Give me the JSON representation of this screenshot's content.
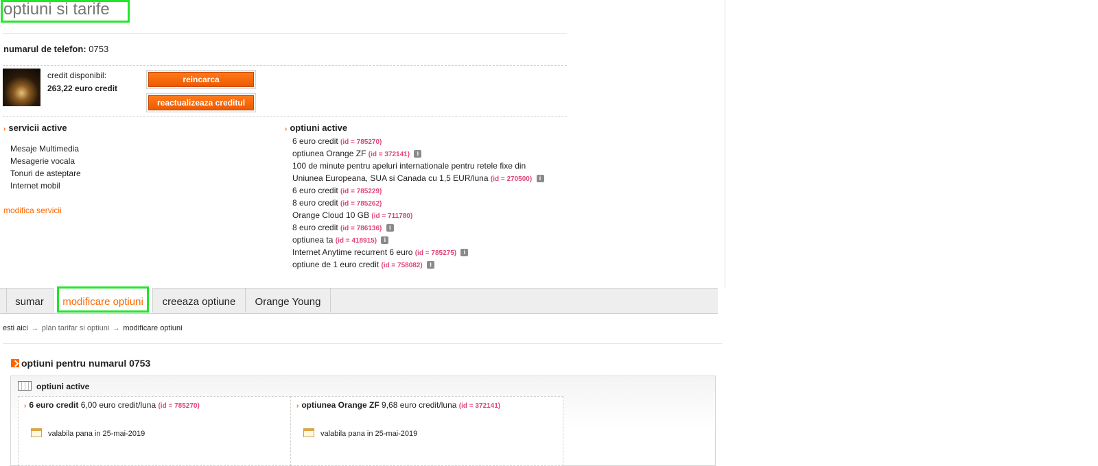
{
  "page": {
    "title": "optiuni si tarife",
    "phone_label": "numarul de telefon:",
    "phone_value": "0753"
  },
  "credit": {
    "label": "credit disponibil:",
    "value": "263,22 euro credit",
    "reincarca_label": "reincarca",
    "reactualizeaza_label": "reactualizeaza creditul"
  },
  "services": {
    "heading": "servicii active",
    "items": [
      "Mesaje Multimedia",
      "Mesagerie vocala",
      "Tonuri de asteptare",
      "Internet mobil"
    ],
    "modify_link": "modifica servicii"
  },
  "options": {
    "heading": "optiuni active",
    "items": [
      {
        "text": "6 euro credit",
        "id": "(id = 785270)"
      },
      {
        "text": "optiunea Orange ZF",
        "id": "(id = 372141)"
      },
      {
        "text": "100 de minute pentru apeluri internationale pentru retele fixe din",
        "id": ""
      },
      {
        "text": "Uniunea Europeana, SUA si Canada cu 1,5 EUR/luna",
        "id": "(id = 270500)"
      },
      {
        "text": "6 euro credit",
        "id": "(id = 785229)"
      },
      {
        "text": "8 euro credit",
        "id": "(id = 785262)"
      },
      {
        "text": "Orange Cloud 10 GB",
        "id": "(id = 711780)"
      },
      {
        "text": "8 euro credit",
        "id": "(id = 786136)"
      },
      {
        "text": "optiunea ta",
        "id": "(id = 418915)"
      },
      {
        "text": "Internet Anytime recurrent 6 euro",
        "id": "(id = 785275)"
      },
      {
        "text": "optiune de 1 euro credit",
        "id": "(id = 758082)"
      }
    ],
    "info_glyph": "i"
  },
  "tabs": [
    "sumar",
    "modificare optiuni",
    "creeaza optiune",
    "Orange Young"
  ],
  "breadcrumb": {
    "prefix": "esti aici",
    "arrow": "→",
    "link": "plan tarifar si optiuni",
    "current": "modificare optiuni"
  },
  "options_section": {
    "title": "optiuni pentru numarul 0753",
    "panel_heading": "optiuni active",
    "cards": [
      {
        "name": "6 euro credit",
        "price": "6,00 euro credit/luna",
        "id": "(id = 785270)",
        "valid": "valabila pana in 25-mai-2019"
      },
      {
        "name": "optiunea Orange ZF",
        "price": "9,68 euro credit/luna",
        "id": "(id = 372141)",
        "valid": "valabila pana in 25-mai-2019"
      }
    ]
  },
  "colors": {
    "accent": "#ff6600",
    "id_tag": "#e0457b",
    "highlight": "#21e62a"
  },
  "icons": {
    "bullet": "chevron-right-icon",
    "info": "info-icon",
    "calendar": "calendar-icon",
    "table": "table-icon"
  }
}
